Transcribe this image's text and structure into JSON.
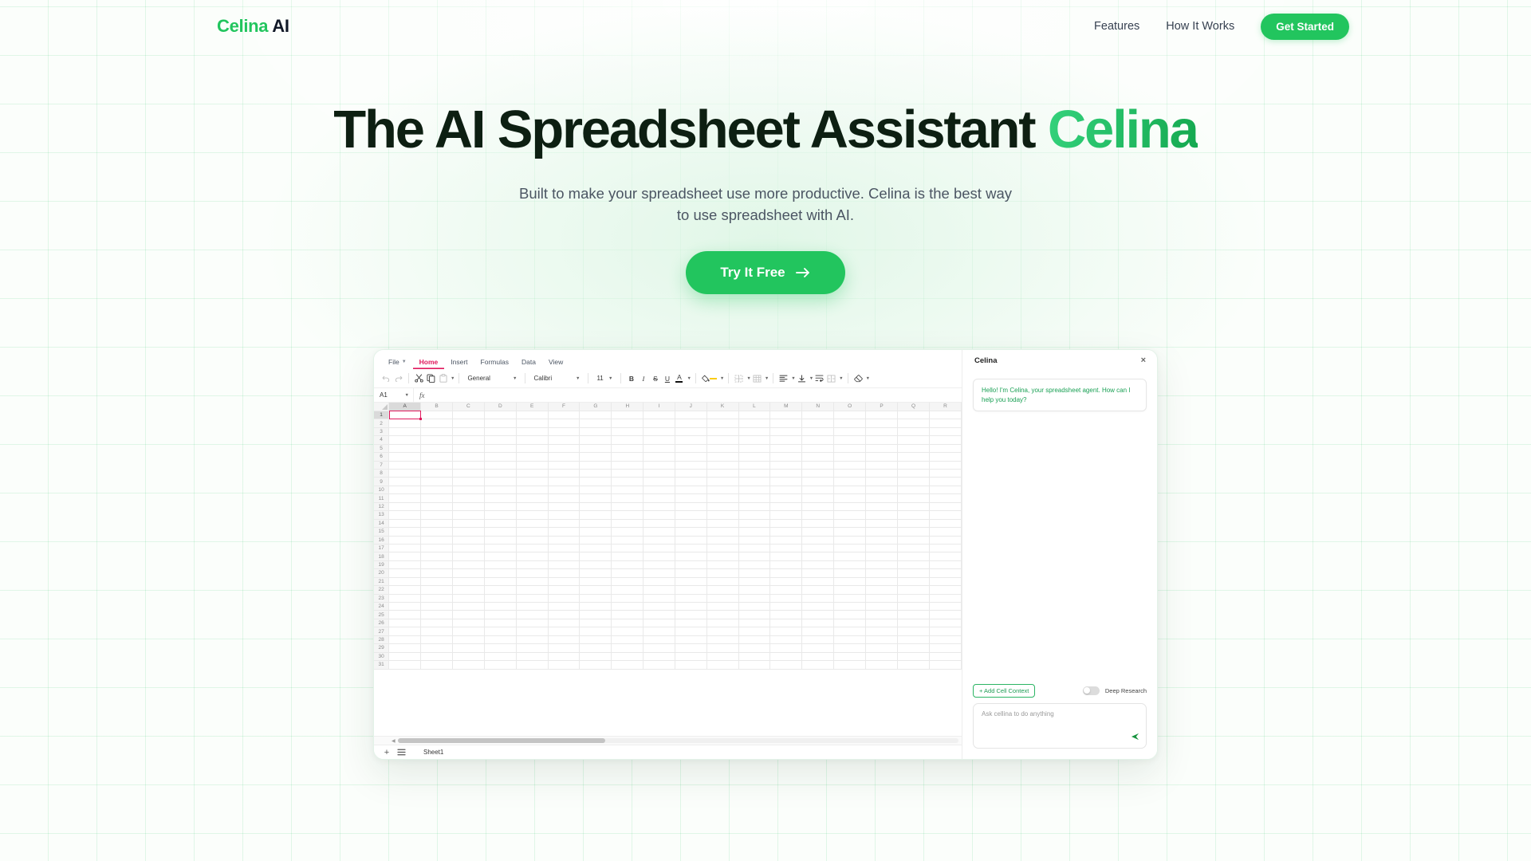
{
  "header": {
    "logo_green": "Celina",
    "logo_dark": "AI",
    "nav": [
      {
        "label": "Features"
      },
      {
        "label": "How It Works"
      }
    ],
    "cta_label": "Get Started"
  },
  "hero": {
    "title_main": "The AI Spreadsheet Assistant ",
    "title_accent": "Celina",
    "subtitle": "Built to make your spreadsheet use more productive. Celina is the best way to use spreadsheet with AI.",
    "cta_label": "Try It Free",
    "cta_icon": "arrow-right-icon"
  },
  "app": {
    "menubar": [
      {
        "label": "File",
        "has_caret": true,
        "active": false
      },
      {
        "label": "Home",
        "has_caret": false,
        "active": true
      },
      {
        "label": "Insert",
        "has_caret": false,
        "active": false
      },
      {
        "label": "Formulas",
        "has_caret": false,
        "active": false
      },
      {
        "label": "Data",
        "has_caret": false,
        "active": false
      },
      {
        "label": "View",
        "has_caret": false,
        "active": false
      }
    ],
    "toolbar": {
      "undo_icon": "undo-icon",
      "redo_icon": "redo-icon",
      "cut_icon": "scissors-icon",
      "copy_icon": "copy-icon",
      "paste_icon": "clipboard-icon",
      "number_format": "General",
      "font_family": "Calibri",
      "font_size": "11",
      "bold": "B",
      "italic": "I",
      "strikethrough": "S",
      "underline": "U",
      "font_color": "A",
      "fill_color_icon": "paint-bucket-icon",
      "borders_icon": "borders-icon",
      "table_icon": "table-icon",
      "align_icon": "align-left-icon",
      "valign_icon": "vertical-align-icon",
      "wrap_icon": "wrap-text-icon",
      "merge_icon": "merge-cells-icon",
      "clear_icon": "eraser-icon"
    },
    "formula_bar": {
      "name_box": "A1",
      "fx_label": "fx",
      "formula_value": "",
      "formula_placeholder": ""
    },
    "grid": {
      "columns": [
        "A",
        "B",
        "C",
        "D",
        "E",
        "F",
        "G",
        "H",
        "I",
        "J",
        "K",
        "L",
        "M",
        "N",
        "O",
        "P",
        "Q",
        "R"
      ],
      "rows": [
        1,
        2,
        3,
        4,
        5,
        6,
        7,
        8,
        9,
        10,
        11,
        12,
        13,
        14,
        15,
        16,
        17,
        18,
        19,
        20,
        21,
        22,
        23,
        24,
        25,
        26,
        27,
        28,
        29,
        30,
        31
      ],
      "selected_cell": "A1",
      "selected_column": "A",
      "selected_row": 1
    },
    "sheet_tabs": {
      "add_icon": "plus-icon",
      "list_icon": "hamburger-menu-icon",
      "tabs": [
        {
          "label": "Sheet1",
          "active": true
        }
      ]
    }
  },
  "chat": {
    "title": "Celina",
    "close_icon": "close-icon",
    "messages": [
      {
        "sender": "assistant",
        "text": "Hello! I'm Celina, your spreadsheet agent. How can I help you today?"
      }
    ],
    "add_context_label": "+ Add Cell Context",
    "deep_research_label": "Deep Research",
    "deep_research_on": false,
    "input_placeholder": "Ask cellina to do anything",
    "send_icon": "send-icon"
  },
  "colors": {
    "brand_green": "#22c55e",
    "accent_pink": "#e0195d",
    "page_bg": "#fbfefb",
    "text_dark": "#0d1f12"
  }
}
